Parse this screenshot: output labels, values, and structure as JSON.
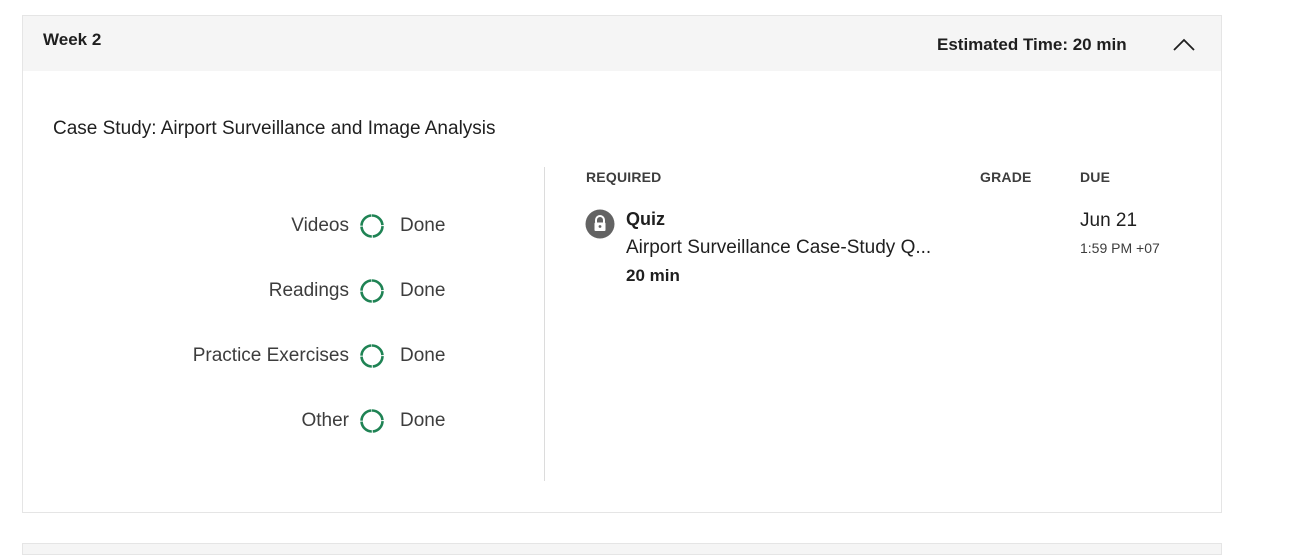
{
  "week": {
    "title": "Week 2",
    "estimated_time": "Estimated Time: 20 min",
    "collapse_icon": "chevron-up-icon"
  },
  "module": {
    "title": "Case Study: Airport Surveillance and Image Analysis",
    "progress": [
      {
        "label": "Videos",
        "status": "Done",
        "icon": "progress-ring-icon"
      },
      {
        "label": "Readings",
        "status": "Done",
        "icon": "progress-ring-icon"
      },
      {
        "label": "Practice Exercises",
        "status": "Done",
        "icon": "progress-ring-icon"
      },
      {
        "label": "Other",
        "status": "Done",
        "icon": "progress-ring-icon"
      }
    ],
    "columns": {
      "required": "REQUIRED",
      "grade": "GRADE",
      "due": "DUE"
    },
    "items": [
      {
        "type": "Quiz",
        "name": "Airport Surveillance Case-Study Q...",
        "duration": "20 min",
        "icon": "lock-icon",
        "grade": "",
        "due_date": "Jun 21",
        "due_time": "1:59 PM +07"
      }
    ]
  },
  "colors": {
    "accent_green": "#1f8354",
    "header_bg": "#f5f5f5",
    "lock_bg": "#636363"
  }
}
